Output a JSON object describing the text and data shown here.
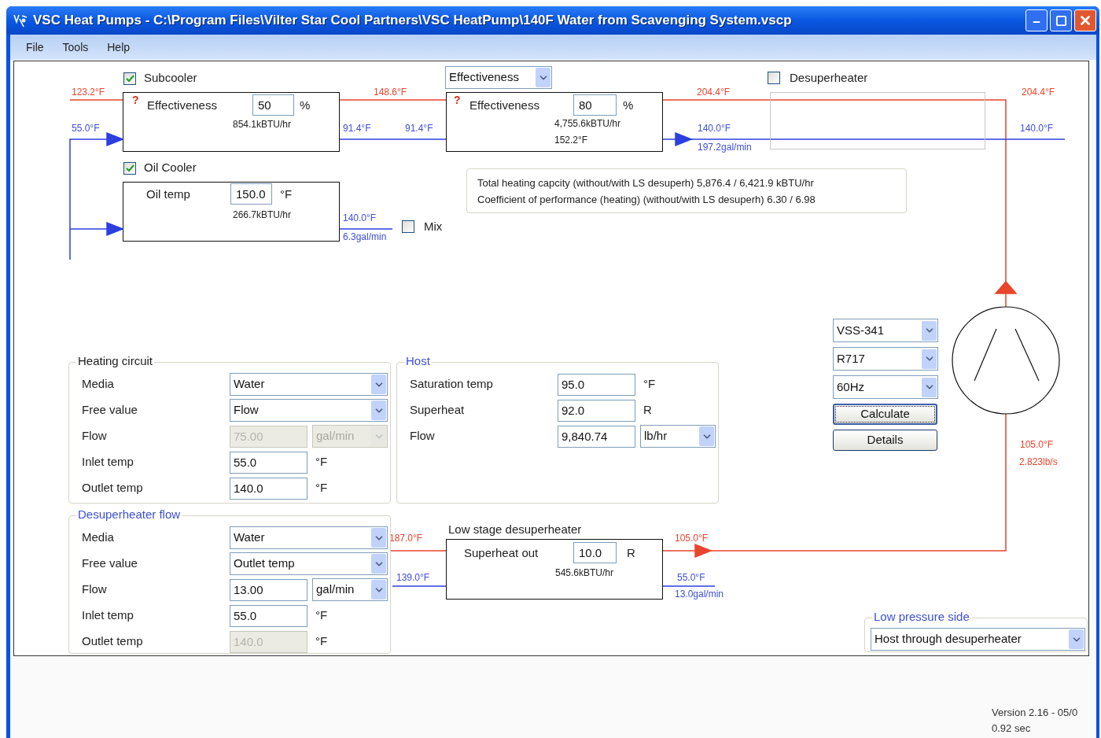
{
  "window": {
    "title": "VSC Heat Pumps - C:\\Program Files\\Vilter Star Cool Partners\\VSC HeatPump\\140F Water from Scavenging System.vscp"
  },
  "menu": [
    "File",
    "Tools",
    "Help"
  ],
  "diagram": {
    "subcooler": {
      "label": "Subcooler",
      "checked": true,
      "help": "?",
      "field_label": "Effectiveness",
      "value": "50",
      "unit": "%",
      "duty": "854.1kBTU/hr",
      "hot_in": "123.2°F",
      "hot_out": "148.6°F",
      "cold_in": "55.0°F",
      "cold_out": "91.4°F"
    },
    "condenser": {
      "mode": "Effectiveness",
      "help": "?",
      "field_label": "Effectiveness",
      "value": "80",
      "unit": "%",
      "duty": "4,755.6kBTU/hr",
      "temp": "152.2°F",
      "cold_in": "91.4°F",
      "hot_in": "204.4°F",
      "cold_out": "140.0°F",
      "flow": "197.2gal/min"
    },
    "desuperheater": {
      "label": "Desuperheater",
      "checked": false,
      "hot_in": "204.4°F",
      "cold_out": "140.0°F"
    },
    "oil_cooler": {
      "label": "Oil Cooler",
      "checked": true,
      "field_label": "Oil temp",
      "value": "150.0",
      "unit": "°F",
      "duty": "266.7kBTU/hr",
      "cold_out": "140.0°F",
      "flow": "6.3gal/min"
    },
    "mix": {
      "label": "Mix",
      "checked": false
    },
    "summary": [
      "Total heating capcity (without/with LS desuperh) 5,876.4 / 6,421.9 kBTU/hr",
      "Coefficient of performance (heating) (without/with LS desuperh) 6.30 / 6.98"
    ],
    "compressor": {
      "temp": "105.0°F",
      "mass_flow": "2.823lb/s"
    },
    "ls_desuperheater": {
      "title": "Low stage desuperheater",
      "field_label": "Superheat out",
      "value": "10.0",
      "unit": "R",
      "duty": "545.6kBTU/hr",
      "hot_in": "187.0°F",
      "hot_out": "105.0°F",
      "cold_in": "139.0°F",
      "cold_out": "55.0°F",
      "flow": "13.0gal/min"
    }
  },
  "selectors": [
    "VSS-341",
    "R717",
    "60Hz"
  ],
  "buttons": [
    {
      "label": "Calculate",
      "focused": true
    },
    {
      "label": "Details",
      "focused": false
    }
  ],
  "groups": [
    {
      "title": "Heating circuit",
      "color": "#1a1a1a",
      "rows": [
        {
          "kind": "select",
          "label": "Media",
          "value": "Water",
          "disabled": false
        },
        {
          "kind": "select",
          "label": "Free value",
          "value": "Flow",
          "disabled": false
        },
        {
          "kind": "input_select",
          "label": "Flow",
          "value": "75.00",
          "unit": "gal/min",
          "disabled": true
        },
        {
          "kind": "input",
          "label": "Inlet temp",
          "value": "55.0",
          "unit": "°F",
          "disabled": false
        },
        {
          "kind": "input",
          "label": "Outlet temp",
          "value": "140.0",
          "unit": "°F",
          "disabled": false
        }
      ]
    },
    {
      "title": "Host",
      "color": "#3c50d0",
      "rows": [
        {
          "kind": "input",
          "label": "Saturation temp",
          "value": "95.0",
          "unit": "°F",
          "disabled": false
        },
        {
          "kind": "input",
          "label": "Superheat",
          "value": "92.0",
          "unit": "R",
          "disabled": false
        },
        {
          "kind": "input_select",
          "label": "Flow",
          "value": "9,840.74",
          "unit": "lb/hr",
          "disabled": false
        }
      ]
    },
    {
      "title": "Desuperheater flow",
      "color": "#3c50d0",
      "rows": [
        {
          "kind": "select",
          "label": "Media",
          "value": "Water",
          "disabled": false
        },
        {
          "kind": "select",
          "label": "Free value",
          "value": "Outlet temp",
          "disabled": false
        },
        {
          "kind": "input_select",
          "label": "Flow",
          "value": "13.00",
          "unit": "gal/min",
          "disabled": false
        },
        {
          "kind": "input",
          "label": "Inlet temp",
          "value": "55.0",
          "unit": "°F",
          "disabled": false
        },
        {
          "kind": "input",
          "label": "Outlet temp",
          "value": "140.0",
          "unit": "°F",
          "disabled": true
        }
      ]
    },
    {
      "title": "Low pressure side",
      "color": "#3c50d0",
      "rows": [
        {
          "kind": "select",
          "value": "Host through desuperheater",
          "disabled": false
        }
      ]
    }
  ],
  "status": [
    "Version 2.16 - 05/0",
    "0.92 sec"
  ]
}
